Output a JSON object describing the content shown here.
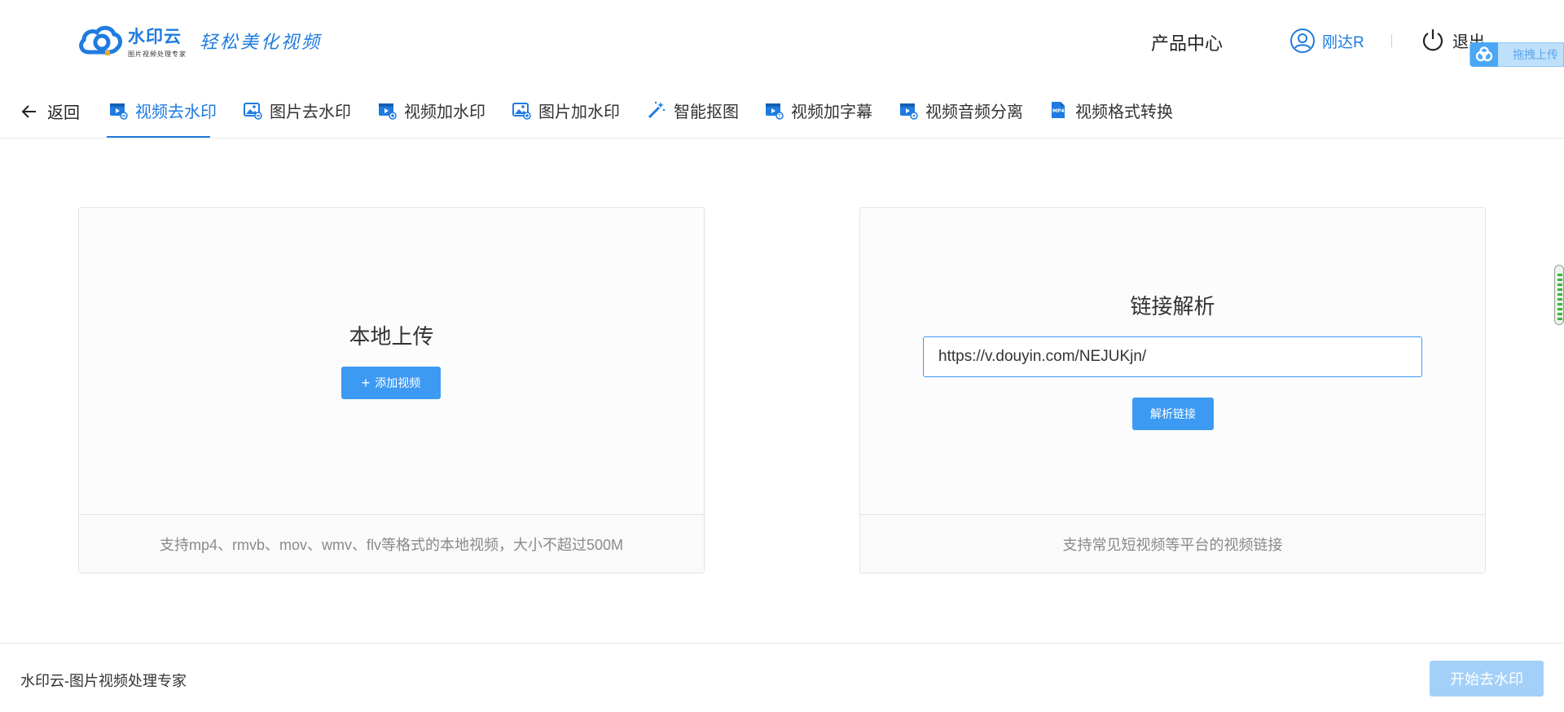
{
  "header": {
    "logo_name": "水印云",
    "logo_sub": "图片视频处理专家",
    "slogan": "轻松美化视频",
    "product_center": "产品中心",
    "user_name": "刚达R",
    "logout": "退出",
    "float_upload": "拖拽上传"
  },
  "tabs": {
    "back": "返回",
    "items": [
      {
        "label": "视频去水印",
        "icon": "video-remove-watermark-icon"
      },
      {
        "label": "图片去水印",
        "icon": "image-remove-watermark-icon"
      },
      {
        "label": "视频加水印",
        "icon": "video-add-watermark-icon"
      },
      {
        "label": "图片加水印",
        "icon": "image-add-watermark-icon"
      },
      {
        "label": "智能抠图",
        "icon": "magic-wand-icon"
      },
      {
        "label": "视频加字幕",
        "icon": "video-subtitle-icon"
      },
      {
        "label": "视频音频分离",
        "icon": "audio-separate-icon"
      },
      {
        "label": "视频格式转换",
        "icon": "mp4-convert-icon"
      }
    ],
    "active_index": 0
  },
  "local_upload": {
    "title": "本地上传",
    "add_button": "添加视频",
    "note": "支持mp4、rmvb、mov、wmv、flv等格式的本地视频，大小不超过500M"
  },
  "link_parse": {
    "title": "链接解析",
    "input_value": "https://v.douyin.com/NEJUKjn/",
    "parse_button": "解析链接",
    "note": "支持常见短视频等平台的视频链接"
  },
  "footer": {
    "brand_text": "水印云-图片视频处理专家",
    "start_button": "开始去水印"
  },
  "colors": {
    "accent": "#1e7be0",
    "button": "#3d9af2",
    "button_disabled": "#a3d0f8"
  }
}
